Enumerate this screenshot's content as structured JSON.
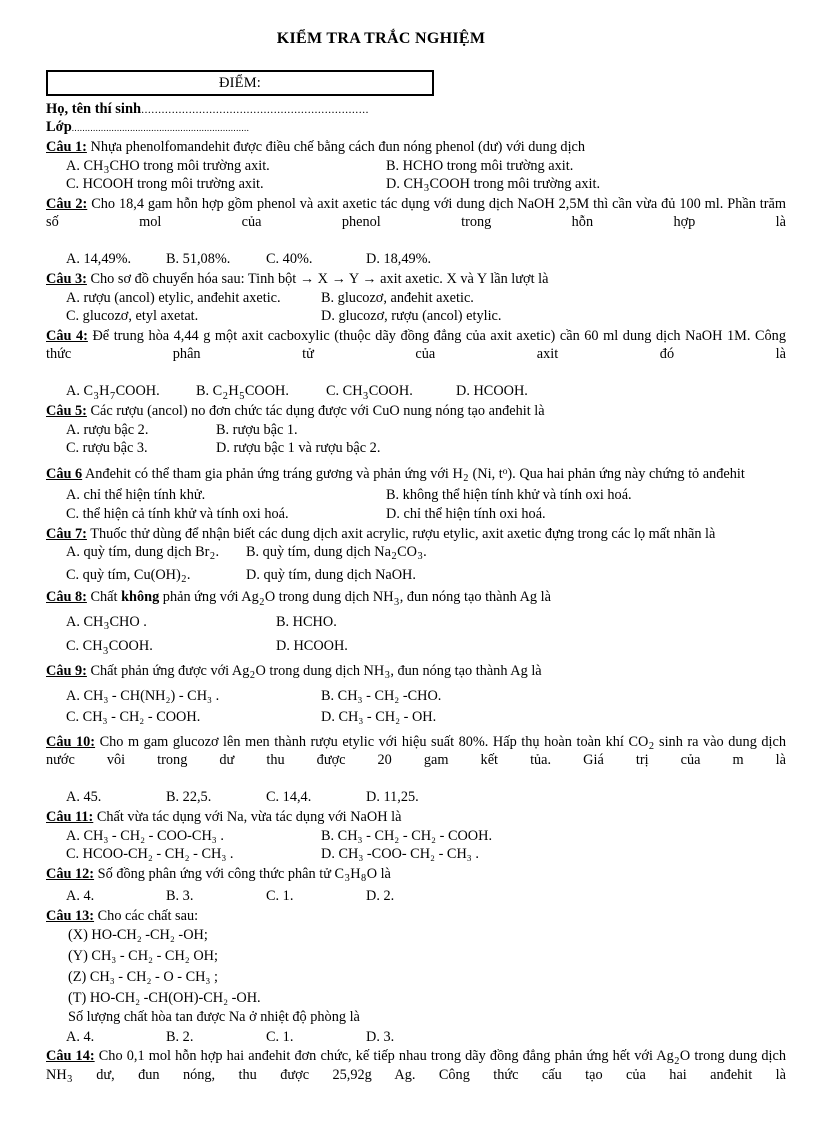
{
  "document": {
    "title": "KIỂM TRA TRẮC NGHIỆM",
    "score_box_label": "ĐIỂM:",
    "name_field_label": "Họ, tên thí sinh",
    "name_field_dots": "...................................................................",
    "class_field_label": "Lớp",
    "class_field_dots": "..................................................................."
  },
  "questions": [
    {
      "label": "Câu 1:",
      "stem": "Nhựa phenolfomandehit được điều chế bằng cách đun nóng phenol (dư) với dung dịch",
      "optA_pre": "A. CH",
      "optA_sub": "3",
      "optA_post": "CHO trong môi trường axit.",
      "optB": "B. HCHO trong môi trường axit.",
      "optC": "C. HCOOH trong môi trường axit.",
      "optD_pre": "D. CH",
      "optD_sub": "3",
      "optD_post": "COOH trong môi trường axit."
    },
    {
      "label": "Câu 2:",
      "stem": "Cho 18,4 gam hỗn hợp gồm phenol và axit axetic tác dụng với dung dịch NaOH 2,5M thì cần vừa đủ 100 ml. Phần trăm số mol của phenol trong hỗn hợp là",
      "optA": "A. 14,49%.",
      "optB": "B. 51,08%.",
      "optC": "C. 40%.",
      "optD": "D. 18,49%."
    },
    {
      "label": "Câu 3:",
      "stem": "Cho sơ đồ chuyển hóa sau: Tinh bột → X → Y → axit axetic. X và Y lần lượt là",
      "optA": "A. rượu (ancol) etylic, anđehit axetic.",
      "optB": "B. glucozơ, anđehit axetic.",
      "optC": "C. glucozơ, etyl axetat.",
      "optD": "D. glucozơ, rượu (ancol) etylic."
    },
    {
      "label": "Câu 4:",
      "stem": "Để trung hòa 4,44 g một axit cacboxylic (thuộc dãy đồng đẳng của axit axetic) cần 60 ml dung dịch NaOH 1M. Công thức phân tử của axit đó là",
      "optA_pre": "A. C",
      "optA_s1": "3",
      "optA_mid": "H",
      "optA_s2": "7",
      "optA_post": "COOH.",
      "optB_pre": "B. C",
      "optB_s1": "2",
      "optB_mid": "H",
      "optB_s2": "5",
      "optB_post": "COOH.",
      "optC_pre": "C. CH",
      "optC_sub": "3",
      "optC_post": "COOH.",
      "optD": "D. HCOOH."
    },
    {
      "label": "Câu 5:",
      "stem": "Các rượu (ancol) no đơn chức tác dụng được với CuO nung nóng tạo anđehit là",
      "optA": "A. rượu bậc 2.",
      "optB": "B. rượu bậc 1.",
      "optC": "C. rượu bậc 3.",
      "optD": "D. rượu bậc 1 và rượu bậc 2."
    },
    {
      "label": "Câu 6",
      "stem_pre": "Anđehit có thể tham gia phản ứng tráng gương và phản ứng với H",
      "stem_sub": "2",
      "stem_mid": " (Ni, t",
      "stem_sup": "o",
      "stem_post": "). Qua hai phản ứng này chứng tỏ anđehit",
      "optA": "A. chỉ thể hiện tính khử.",
      "optB": "B. không thể hiện tính khử và tính oxi hoá.",
      "optC": "C. thể hiện cả tính khử và tính oxi hoá.",
      "optD": "D. chỉ thể hiện tính oxi hoá."
    },
    {
      "label": "Câu 7:",
      "stem": "Thuốc thử dùng để nhận biết các dung dịch axit acrylic, rượu etylic, axit axetic đựng trong các lọ mất nhãn là",
      "optA_pre": "A. quỳ tím, dung dịch Br",
      "optA_sub": "2",
      "optA_post": ".",
      "optB_pre": "B. quỳ tím, dung dịch Na",
      "optB_s1": "2",
      "optB_mid": "CO",
      "optB_s2": "3",
      "optB_post": ".",
      "optC_pre": "C. quỳ tím, Cu(OH)",
      "optC_sub": "2",
      "optC_post": ".",
      "optD": "D. quỳ tím, dung dịch NaOH."
    },
    {
      "label": "Câu 8:",
      "stem_pre": "Chất ",
      "stem_bold": "không",
      "stem_mid1": " phản ứng với Ag",
      "stem_sub1": "2",
      "stem_mid2": "O trong dung dịch NH",
      "stem_sub2": "3",
      "stem_post": ", đun nóng tạo thành Ag là",
      "optA_pre": "A. CH",
      "optA_sub": "3",
      "optA_post": "CHO .",
      "optB": "B. HCHO.",
      "optC_pre": "C. CH",
      "optC_sub": "3",
      "optC_post": "COOH.",
      "optD": "D. HCOOH."
    },
    {
      "label": "Câu 9:",
      "stem_pre": "Chất phản ứng được với Ag",
      "stem_sub1": "2",
      "stem_mid": "O trong dung dịch NH",
      "stem_sub2": "3",
      "stem_post": ", đun nóng tạo thành Ag là",
      "optA": "A. CH₃ - CH(NH₂) - CH₃ .",
      "optB": "B. CH₃ - CH₂ -CHO.",
      "optC": "C. CH₃ - CH₂ - COOH.",
      "optD": "D. CH₃ - CH₂ - OH."
    },
    {
      "label": "Câu 10:",
      "stem_pre": "Cho m gam glucozơ lên men thành rượu etylic với hiệu suất 80%. Hấp thụ hoàn toàn khí CO",
      "stem_sub": "2",
      "stem_post": " sinh ra vào dung dịch nước vôi trong dư thu được 20 gam kết tủa. Giá trị của m là",
      "optA": "A. 45.",
      "optB": "B. 22,5.",
      "optC": "C. 14,4.",
      "optD": "D. 11,25."
    },
    {
      "label": "Câu 11:",
      "stem": "Chất vừa tác dụng với Na, vừa tác dụng với NaOH là",
      "optA": "A. CH₃ - CH₂ - COO-CH₃ .",
      "optB": "B. CH₃ - CH₂ - CH₂ - COOH.",
      "optC": "C. HCOO-CH₂ - CH₂ - CH₃ .",
      "optD": "D. CH₃ -COO- CH₂ - CH₃ ."
    },
    {
      "label": "Câu 12:",
      "stem_pre": "Số đồng phân ứng với công thức phân tử C",
      "stem_s1": "3",
      "stem_mid": "H",
      "stem_s2": "8",
      "stem_post": "O là",
      "optA": "A. 4.",
      "optB": "B. 3.",
      "optC": "C. 1.",
      "optD": "D. 2."
    },
    {
      "label": "Câu 13:",
      "stem": "Cho các chất sau:",
      "items": [
        "(X) HO-CH₂ -CH₂ -OH;",
        "(Y) CH₃ - CH₂ - CH₂ OH;",
        "(Z) CH₃ - CH₂ - O - CH₃ ;",
        "(T) HO-CH₂ -CH(OH)-CH₂ -OH."
      ],
      "sub_question": "Số lượng chất hòa tan được Na ở nhiệt độ phòng là",
      "optA": "A. 4.",
      "optB": "B. 2.",
      "optC": "C. 1.",
      "optD": "D. 3."
    },
    {
      "label": "Câu 14:",
      "stem_pre": "Cho 0,1 mol hỗn hợp hai anđehit đơn chức, kế tiếp nhau trong dãy đồng đẳng phản ứng hết với Ag",
      "stem_sub1": "2",
      "stem_mid": "O trong dung dịch NH",
      "stem_sub2": "3",
      "stem_post": " dư, đun nóng, thu được 25,92g Ag. Công thức cấu tạo của hai anđehit là"
    }
  ]
}
